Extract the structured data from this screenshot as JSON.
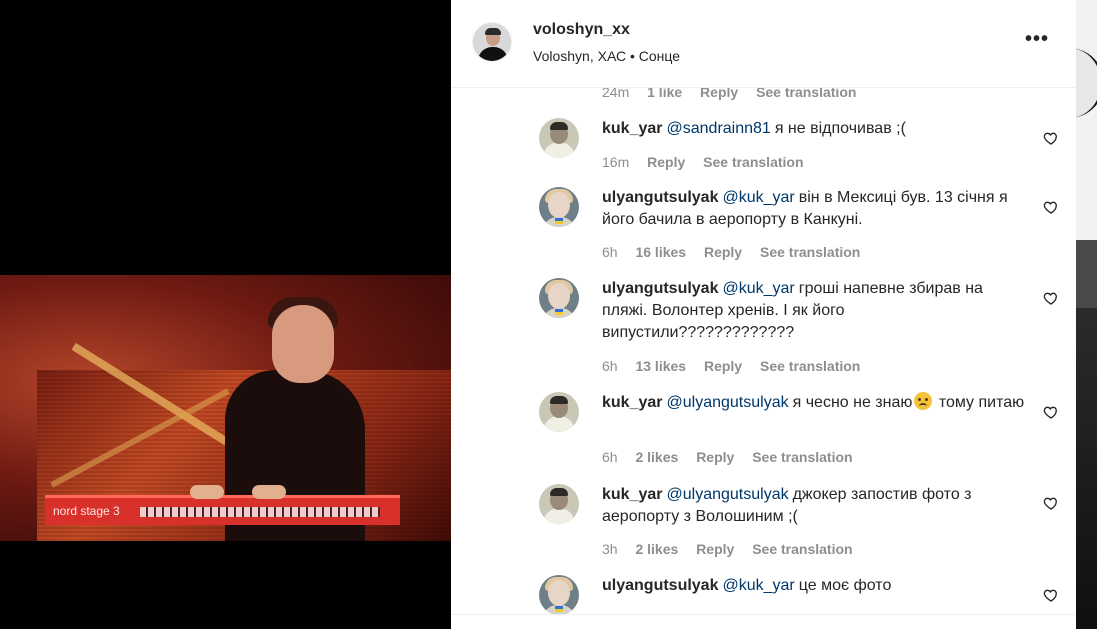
{
  "post": {
    "username": "voloshyn_xx",
    "subline": "Voloshyn, ХАС • Сонце",
    "more_icon": "more-horizontal-icon"
  },
  "video": {
    "keyboard_label": "nord stage 3"
  },
  "top_partial_meta": {
    "time": "24m",
    "likes": "1 like",
    "reply": "Reply",
    "translate": "See translation"
  },
  "comments": [
    {
      "user": "kuk_yar",
      "mention": "@sandrainn81",
      "text": "я не відпочивав ;(",
      "time": "16m",
      "likes": "",
      "reply": "Reply",
      "translate": "See translation"
    },
    {
      "user": "ulyangutsulyak",
      "mention": "@kuk_yar",
      "text": "він в Мексиці був. 13 січня я його бачила в аеропорту в Канкуні.",
      "time": "6h",
      "likes": "16 likes",
      "reply": "Reply",
      "translate": "See translation"
    },
    {
      "user": "ulyangutsulyak",
      "mention": "@kuk_yar",
      "text": "гроші напевне збирав на пляжі. Волонтер хренів. І як його випустили?????????????",
      "time": "6h",
      "likes": "13 likes",
      "reply": "Reply",
      "translate": "See translation"
    },
    {
      "user": "kuk_yar",
      "mention": "@ulyangutsulyak",
      "text_before": "я чесно не знаю",
      "text_after": "тому питаю",
      "emoji": "sad-face-emoji",
      "time": "6h",
      "likes": "2 likes",
      "reply": "Reply",
      "translate": "See translation"
    },
    {
      "user": "kuk_yar",
      "mention": "@ulyangutsulyak",
      "text": "джокер запостив фото з аеропорту з Волошиним ;(",
      "time": "3h",
      "likes": "2 likes",
      "reply": "Reply",
      "translate": "See translation"
    },
    {
      "user": "ulyangutsulyak",
      "mention": "@kuk_yar",
      "text": "це моє фото",
      "time": "",
      "likes": "",
      "reply": "",
      "translate": ""
    }
  ],
  "colors": {
    "mention": "#00376b",
    "meta": "#8e8e8e",
    "text": "#262626"
  }
}
